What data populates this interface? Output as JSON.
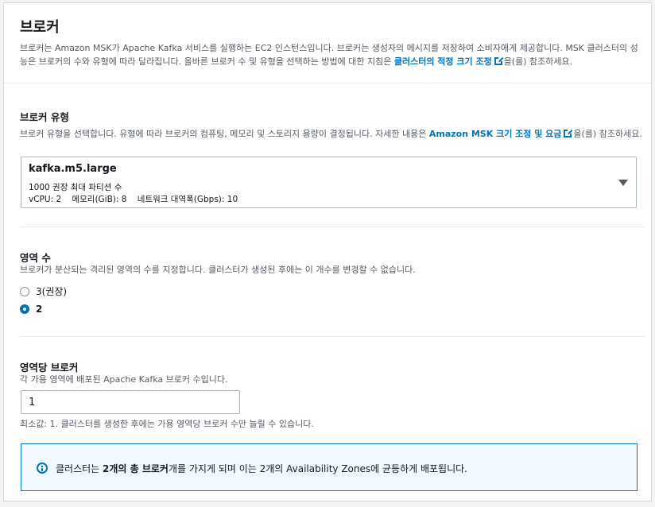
{
  "header": {
    "title": "브로커",
    "desc_pre": "브로커는 Amazon MSK가 Apache Kafka 서비스를 실행하는 EC2 인스턴스입니다. 브로커는 생성자의 메시지를 저장하여 소비자에게 제공합니다. MSK 클러스터의 성능은 브로커의 수와 유형에 따라 달라집니다. 올바른 브로커 수 및 유형을 선택하는 방법에 대한 지침은 ",
    "desc_link": "클러스터의 적정 크기 조정",
    "desc_post": "을(를) 참조하세요."
  },
  "broker_type": {
    "label": "브로커 유형",
    "desc_pre": "브로커 유형을 선택합니다. 유형에 따라 브로커의 컴퓨팅, 메모리 및 스토리지 용량이 결정됩니다. 자세한 내용은 ",
    "desc_link": "Amazon MSK 크기 조정 및 요금",
    "desc_post": "을(를) 참조하세요.",
    "selected": "kafka.m5.large",
    "line2": "1000 권장 최대 파티션 수",
    "line3": "vCPU: 2    메모리(GiB): 8    네트워크 대역폭(Gbps): 10"
  },
  "zones": {
    "label": "영역 수",
    "desc": "브로커가 분산되는 격리된 영역의 수를 지정합니다. 클러스터가 생성된 후에는 이 개수를 변경할 수 없습니다.",
    "options": [
      {
        "label": "3(권장)",
        "selected": false
      },
      {
        "label": "2",
        "selected": true
      }
    ]
  },
  "brokers_per_zone": {
    "label": "영역당 브로커",
    "desc": "각 가용 영역에 배포된 Apache Kafka 브로커 수입니다.",
    "value": "1",
    "constraint": "최소값: 1. 클러스터를 생성한 후에는 가용 영역당 브로커 수만 늘릴 수 있습니다."
  },
  "alert": {
    "pre": "클러스터는 ",
    "bold": "2개의 총 브로커",
    "post": "개를 가지게 되며 이는 2개의 Availability Zones에 균등하게 배포됩니다."
  },
  "colors": {
    "link": "#0073bb",
    "text": "#16191f",
    "muted": "#545b64",
    "alert_bg": "#f1faff"
  }
}
